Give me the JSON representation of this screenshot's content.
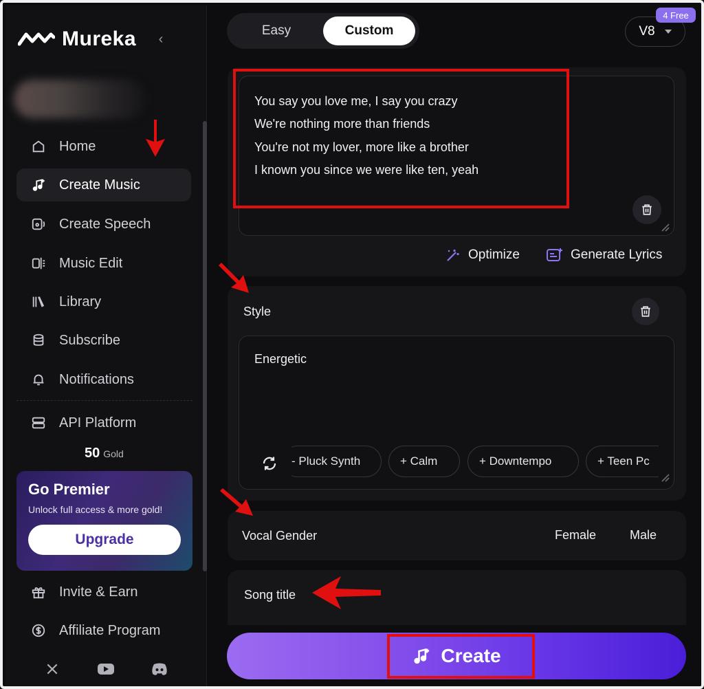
{
  "app": {
    "name": "Mureka"
  },
  "sidebar": {
    "nav": [
      {
        "label": "Home",
        "icon": "home-icon"
      },
      {
        "label": "Create Music",
        "icon": "music-note-icon",
        "active": true
      },
      {
        "label": "Create Speech",
        "icon": "speech-icon"
      },
      {
        "label": "Music Edit",
        "icon": "music-edit-icon"
      },
      {
        "label": "Library",
        "icon": "library-icon"
      },
      {
        "label": "Subscribe",
        "icon": "database-icon"
      },
      {
        "label": "Notifications",
        "icon": "bell-icon"
      },
      {
        "label": "API Platform",
        "icon": "server-icon"
      },
      {
        "label": "Invite & Earn",
        "icon": "gift-icon"
      },
      {
        "label": "Affiliate Program",
        "icon": "dollar-icon"
      }
    ],
    "gold": {
      "amount": "50",
      "unit": "Gold"
    },
    "premier": {
      "title": "Go Premier",
      "subtitle": "Unlock full access & more gold!",
      "button": "Upgrade"
    },
    "social": [
      "x-icon",
      "youtube-icon",
      "discord-icon"
    ]
  },
  "main": {
    "modes": {
      "easy": "Easy",
      "custom": "Custom",
      "selected": "Custom"
    },
    "version": {
      "label": "V8",
      "badge": "4 Free"
    },
    "lyrics": {
      "lines": [
        "You say you love me, I say you crazy",
        "We're nothing more than friends",
        "You're not my lover, more like a brother",
        "I known you since we were like ten, yeah"
      ],
      "optimize": "Optimize",
      "generate": "Generate Lyrics"
    },
    "style": {
      "label": "Style",
      "value": "Energetic",
      "tags": [
        "- Pluck Synth",
        "+ Calm",
        "+ Downtempo",
        "+ Teen Pc"
      ]
    },
    "vocal_gender": {
      "label": "Vocal Gender",
      "options": [
        "Female",
        "Male"
      ]
    },
    "song_title": {
      "label": "Song title"
    },
    "create": "Create"
  },
  "colors": {
    "accent": "#7d48ea",
    "background": "#0d0d0f",
    "panel": "#161619",
    "annotation": "#e01010"
  }
}
